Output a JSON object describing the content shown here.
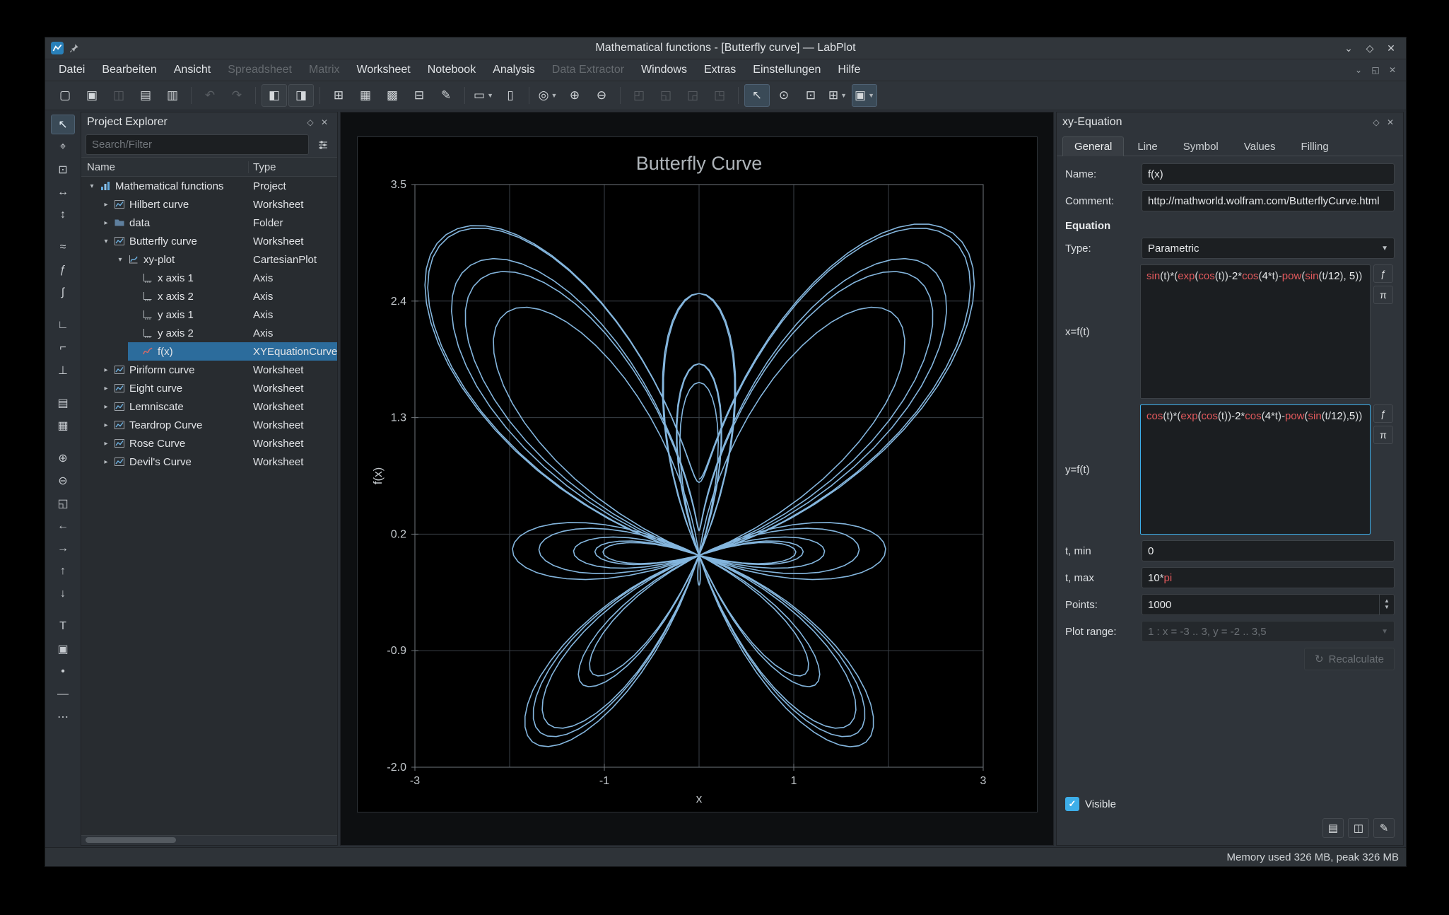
{
  "window": {
    "title": "Mathematical functions - [Butterfly curve] — LabPlot",
    "controls": [
      {
        "name": "shade-button",
        "glyph": "⌄"
      },
      {
        "name": "maximize-button",
        "glyph": "◇"
      },
      {
        "name": "close-button",
        "glyph": "✕"
      }
    ]
  },
  "menubar": {
    "items": [
      {
        "label": "Datei",
        "enabled": true
      },
      {
        "label": "Bearbeiten",
        "enabled": true
      },
      {
        "label": "Ansicht",
        "enabled": true
      },
      {
        "label": "Spreadsheet",
        "enabled": false
      },
      {
        "label": "Matrix",
        "enabled": false
      },
      {
        "label": "Worksheet",
        "enabled": true
      },
      {
        "label": "Notebook",
        "enabled": true
      },
      {
        "label": "Analysis",
        "enabled": true
      },
      {
        "label": "Data Extractor",
        "enabled": false
      },
      {
        "label": "Windows",
        "enabled": true
      },
      {
        "label": "Extras",
        "enabled": true
      },
      {
        "label": "Einstellungen",
        "enabled": true
      },
      {
        "label": "Hilfe",
        "enabled": true
      }
    ],
    "mdi_controls": [
      {
        "name": "mdi-minimize-button",
        "glyph": "⌄"
      },
      {
        "name": "mdi-restore-button",
        "glyph": "◱"
      },
      {
        "name": "mdi-close-button",
        "glyph": "✕"
      }
    ]
  },
  "toolbar": {
    "groups": [
      {
        "items": [
          {
            "name": "new-project-button",
            "glyph": "▢"
          },
          {
            "name": "open-project-button",
            "glyph": "▣"
          },
          {
            "name": "save-project-button",
            "glyph": "◫",
            "state": "disabled"
          },
          {
            "name": "print-button",
            "glyph": "▤"
          },
          {
            "name": "print-preview-button",
            "glyph": "▥"
          }
        ]
      },
      {
        "items": [
          {
            "name": "undo-button",
            "glyph": "↶",
            "state": "disabled"
          },
          {
            "name": "redo-button",
            "glyph": "↷",
            "state": "disabled"
          }
        ]
      },
      {
        "items": [
          {
            "name": "tile-windows-button",
            "glyph": "◧",
            "state": "raised"
          },
          {
            "name": "cascade-windows-button",
            "glyph": "◨",
            "state": "raised"
          }
        ]
      },
      {
        "items": [
          {
            "name": "new-spreadsheet-button",
            "glyph": "⊞"
          },
          {
            "name": "new-matrix-button",
            "glyph": "▦"
          },
          {
            "name": "import-data-button",
            "glyph": "▩"
          },
          {
            "name": "export-data-button",
            "glyph": "⊟"
          },
          {
            "name": "color-theme-button",
            "glyph": "✎"
          }
        ]
      },
      {
        "items": [
          {
            "name": "new-worksheet-button",
            "glyph": "▭",
            "dropdown": true
          },
          {
            "name": "new-notebook-button",
            "glyph": "▯"
          }
        ]
      },
      {
        "items": [
          {
            "name": "zoom-button",
            "glyph": "◎",
            "dropdown": true
          },
          {
            "name": "zoom-in-button",
            "glyph": "⊕"
          },
          {
            "name": "zoom-out-button",
            "glyph": "⊖"
          }
        ]
      },
      {
        "items": [
          {
            "name": "plot-tool-1-button",
            "glyph": "◰",
            "state": "disabled"
          },
          {
            "name": "plot-tool-2-button",
            "glyph": "◱",
            "state": "disabled"
          },
          {
            "name": "plot-tool-3-button",
            "glyph": "◲",
            "state": "disabled"
          },
          {
            "name": "plot-tool-4-button",
            "glyph": "◳",
            "state": "disabled"
          }
        ]
      },
      {
        "items": [
          {
            "name": "select-mode-button",
            "glyph": "↖",
            "state": "checked"
          },
          {
            "name": "navigate-mode-button",
            "glyph": "⊙"
          },
          {
            "name": "zoom-select-mode-button",
            "glyph": "⊡"
          },
          {
            "name": "add-plot-button",
            "glyph": "⊞",
            "dropdown": true
          },
          {
            "name": "layout-mode-button",
            "glyph": "▣",
            "state": "checked",
            "dropdown": true
          }
        ]
      }
    ]
  },
  "side_toolbar": {
    "groups": [
      [
        {
          "name": "select-tool",
          "glyph": "↖",
          "state": "checked"
        },
        {
          "name": "crosshair-tool",
          "glyph": "⌖"
        },
        {
          "name": "zoom-select-tool",
          "glyph": "⊡"
        },
        {
          "name": "zoom-x-select-tool",
          "glyph": "↔"
        },
        {
          "name": "zoom-y-select-tool",
          "glyph": "↕"
        }
      ],
      [
        {
          "name": "add-curve-tool",
          "glyph": "≈"
        },
        {
          "name": "add-equation-curve-tool",
          "glyph": "ƒ"
        },
        {
          "name": "add-fit-curve-tool",
          "glyph": "∫"
        }
      ],
      [
        {
          "name": "add-axis-tool",
          "glyph": "∟"
        },
        {
          "name": "add-top-axis-tool",
          "glyph": "⌐"
        },
        {
          "name": "add-custom-axis-tool",
          "glyph": "⊥"
        }
      ],
      [
        {
          "name": "add-legend-tool",
          "glyph": "▤"
        },
        {
          "name": "add-grid-tool",
          "glyph": "▦"
        }
      ],
      [
        {
          "name": "box-zoom-in-tool",
          "glyph": "⊕"
        },
        {
          "name": "box-zoom-out-tool",
          "glyph": "⊖"
        },
        {
          "name": "zoom-fit-tool",
          "glyph": "◱"
        },
        {
          "name": "shift-left-tool",
          "glyph": "←"
        },
        {
          "name": "shift-right-tool",
          "glyph": "→"
        },
        {
          "name": "shift-up-tool",
          "glyph": "↑"
        },
        {
          "name": "shift-down-tool",
          "glyph": "↓"
        }
      ],
      [
        {
          "name": "add-text-label-tool",
          "glyph": "T"
        },
        {
          "name": "add-image-tool",
          "glyph": "▣"
        },
        {
          "name": "add-point-tool",
          "glyph": "•"
        },
        {
          "name": "add-reference-line-tool",
          "glyph": "―"
        },
        {
          "name": "more-tools",
          "glyph": "⋯"
        }
      ]
    ]
  },
  "project_explorer": {
    "title": "Project Explorer",
    "search_placeholder": "Search/Filter",
    "columns": [
      "Name",
      "Type"
    ],
    "rows": [
      {
        "name": "Mathematical functions",
        "type": "Project",
        "level": 0,
        "expander": "expanded",
        "icon": "project"
      },
      {
        "name": "Hilbert curve",
        "type": "Worksheet",
        "level": 1,
        "expander": "collapsed",
        "icon": "worksheet"
      },
      {
        "name": "data",
        "type": "Folder",
        "level": 1,
        "expander": "collapsed",
        "icon": "folder"
      },
      {
        "name": "Butterfly curve",
        "type": "Worksheet",
        "level": 1,
        "expander": "expanded",
        "icon": "worksheet"
      },
      {
        "name": "xy-plot",
        "type": "CartesianPlot",
        "level": 2,
        "expander": "expanded",
        "icon": "plot"
      },
      {
        "name": "x axis 1",
        "type": "Axis",
        "level": 3,
        "expander": "none",
        "icon": "axis"
      },
      {
        "name": "x axis 2",
        "type": "Axis",
        "level": 3,
        "expander": "none",
        "icon": "axis"
      },
      {
        "name": "y axis 1",
        "type": "Axis",
        "level": 3,
        "expander": "none",
        "icon": "axis"
      },
      {
        "name": "y axis 2",
        "type": "Axis",
        "level": 3,
        "expander": "none",
        "icon": "axis"
      },
      {
        "name": "f(x)",
        "type": "XYEquationCurve",
        "level": 3,
        "expander": "none",
        "icon": "curve",
        "selected": true
      },
      {
        "name": "Piriform curve",
        "type": "Worksheet",
        "level": 1,
        "expander": "collapsed",
        "icon": "worksheet"
      },
      {
        "name": "Eight curve",
        "type": "Worksheet",
        "level": 1,
        "expander": "collapsed",
        "icon": "worksheet"
      },
      {
        "name": "Lemniscate",
        "type": "Worksheet",
        "level": 1,
        "expander": "collapsed",
        "icon": "worksheet"
      },
      {
        "name": "Teardrop Curve",
        "type": "Worksheet",
        "level": 1,
        "expander": "collapsed",
        "icon": "worksheet"
      },
      {
        "name": "Rose Curve",
        "type": "Worksheet",
        "level": 1,
        "expander": "collapsed",
        "icon": "worksheet"
      },
      {
        "name": "Devil's Curve",
        "type": "Worksheet",
        "level": 1,
        "expander": "collapsed",
        "icon": "worksheet"
      }
    ]
  },
  "chart_data": {
    "type": "line",
    "title": "Butterfly Curve",
    "xlabel": "x",
    "ylabel": "f(x)",
    "xlim": [
      -3,
      3
    ],
    "ylim": [
      -2.0,
      3.5
    ],
    "x_gridlines": [
      -3,
      -2,
      -1,
      0,
      1,
      2,
      3
    ],
    "x_tick_values": [
      -3,
      -1,
      1,
      3
    ],
    "x_tick_labels": [
      "-3",
      "-1",
      "1",
      "3"
    ],
    "y_tick_values": [
      3.5,
      2.4,
      1.3,
      0.2,
      -0.9,
      -2.0
    ],
    "y_tick_labels": [
      "3.5",
      "2.4",
      "1.3",
      "0.2",
      "-0.9",
      "-2.0"
    ],
    "grid": true,
    "legend": "none",
    "curve_color": "#84b6de",
    "parametric": {
      "x_formula": "sin(t)*(exp(cos(t))-2*cos(4*t)-pow(sin(t/12), 5))",
      "y_formula": "cos(t)*(exp(cos(t))-2*cos(4*t)-pow(sin(t/12),5))",
      "t_min": 0,
      "t_max": "10*pi",
      "points": 1000
    }
  },
  "properties": {
    "dock_title": "xy-Equation",
    "tabs": [
      "General",
      "Line",
      "Symbol",
      "Values",
      "Filling"
    ],
    "active_tab": "General",
    "name_label": "Name:",
    "name_value": "f(x)",
    "comment_label": "Comment:",
    "comment_value": "http://mathworld.wolfram.com/ButterflyCurve.html",
    "section_equation": "Equation",
    "type_label": "Type:",
    "type_value": "Parametric",
    "x_label": "x=f(t)",
    "x_formula": "sin(t)*(exp(cos(t))-2*cos(4*t)-pow(sin(t/12), 5))",
    "y_label": "y=f(t)",
    "y_formula": "cos(t)*(exp(cos(t))-2*cos(4*t)-pow(sin(t/12),5))",
    "insert_function_glyph": "ƒ",
    "insert_constant_glyph": "π",
    "tmin_label": "t, min",
    "tmin_value": "0",
    "tmax_label": "t, max",
    "tmax_value": "10*pi",
    "points_label": "Points:",
    "points_value": "1000",
    "plot_range_label": "Plot range:",
    "plot_range_value": "1 : x = -3 .. 3, y = -2 .. 3,5",
    "recalculate_label": "Recalculate",
    "visible_label": "Visible",
    "visible_checked": true
  },
  "statusbar": {
    "memory": "Memory used 326 MB, peak 326 MB"
  }
}
